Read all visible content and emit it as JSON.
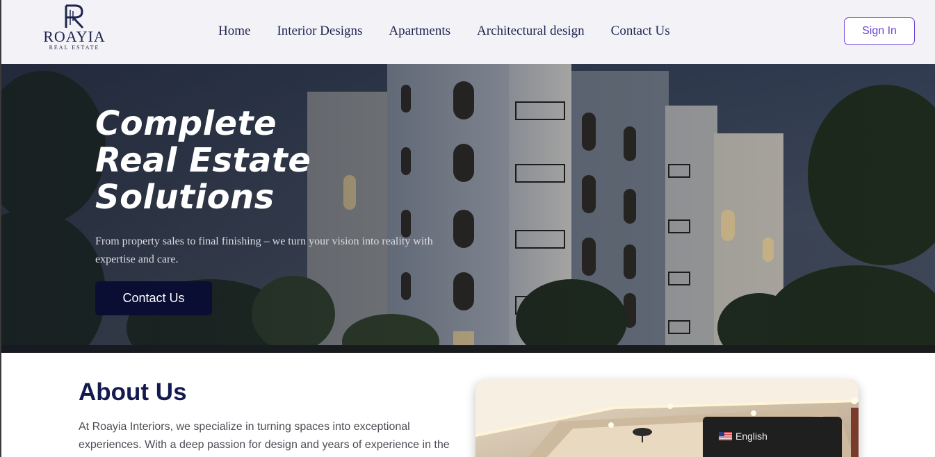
{
  "header": {
    "logo": {
      "name": "ROAYIA",
      "sub": "REAL ESTATE",
      "mark": "R"
    },
    "nav": [
      {
        "label": "Home"
      },
      {
        "label": "Interior Designs"
      },
      {
        "label": "Apartments"
      },
      {
        "label": "Architectural design"
      },
      {
        "label": "Contact Us"
      }
    ],
    "signin_label": "Sign In"
  },
  "hero": {
    "title_lines": [
      "Complete",
      "Real Estate",
      "Solutions"
    ],
    "subtitle": "From property sales to final finishing – we turn your vision into reality with expertise and care.",
    "cta_label": "Contact Us"
  },
  "about": {
    "title": "About Us",
    "text": "At Roayia Interiors, we specialize in turning spaces into exceptional experiences. With a deep passion for design and years of experience in the"
  },
  "language": {
    "label": "English",
    "flag_icon": "us-flag-icon"
  },
  "colors": {
    "navy": "#1d2450",
    "accent_purple": "#6b46d6",
    "cta_dark": "#0b0e33",
    "header_bg": "#f3f2f6"
  }
}
